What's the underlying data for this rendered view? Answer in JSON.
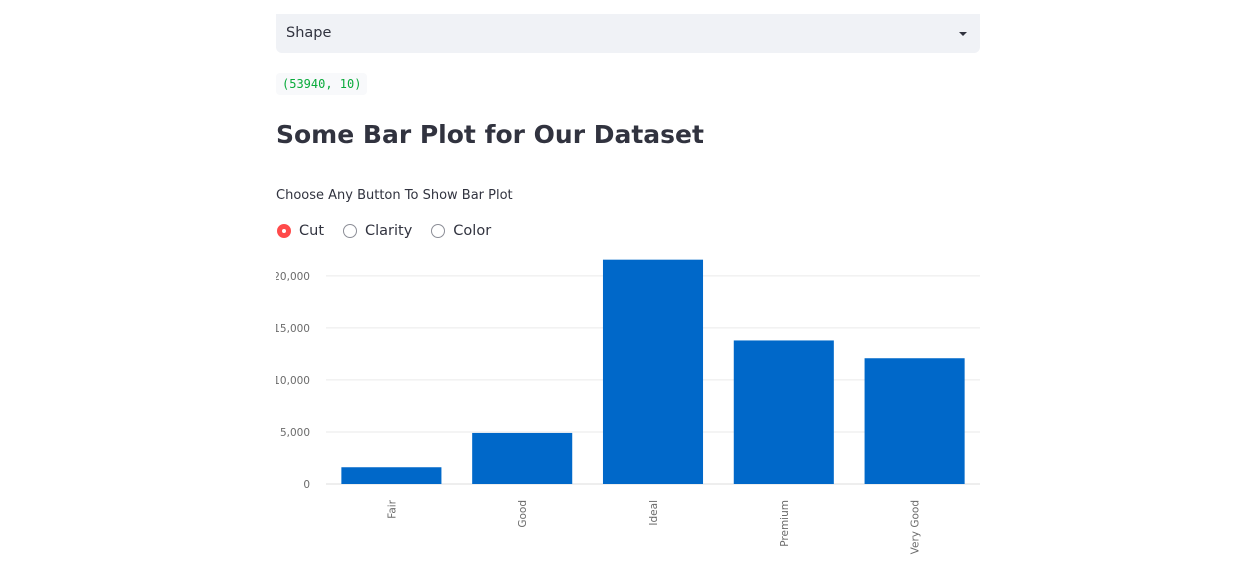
{
  "select": {
    "value": "Shape"
  },
  "output": {
    "text": "(53940, 10)"
  },
  "heading": "Some Bar Plot for Our Dataset",
  "radio": {
    "label": "Choose Any Button To Show Bar Plot",
    "options": [
      "Cut",
      "Clarity",
      "Color"
    ],
    "selected": "Cut"
  },
  "colors": {
    "bar": "#0068c9",
    "radio_selected": "#ff4b4b"
  },
  "chart_data": {
    "type": "bar",
    "categories": [
      "Fair",
      "Good",
      "Ideal",
      "Premium",
      "Very Good"
    ],
    "values": [
      1610,
      4906,
      21551,
      13791,
      12082
    ],
    "yticks": [
      0,
      5000,
      10000,
      15000,
      20000
    ],
    "ytick_labels": [
      "0",
      "5,000",
      "10,000",
      "15,000",
      "20,000"
    ],
    "ylim": [
      0,
      22000
    ],
    "grid": true,
    "title": "",
    "xlabel": "",
    "ylabel": ""
  }
}
